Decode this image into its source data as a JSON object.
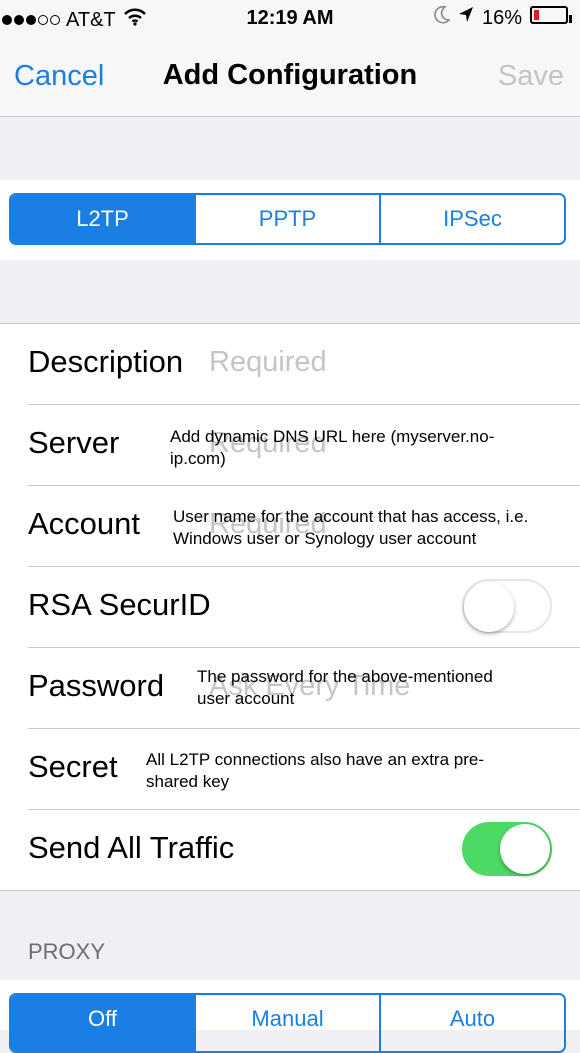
{
  "status_bar": {
    "carrier": "AT&T",
    "time": "12:19 AM",
    "battery": "16%",
    "signal_bars": 3,
    "signal_total": 5,
    "battery_level": 0.16
  },
  "nav": {
    "cancel": "Cancel",
    "title": "Add Configuration",
    "save": "Save"
  },
  "vpn_type": {
    "options": [
      "L2TP",
      "PPTP",
      "IPSec"
    ],
    "selected": "L2TP"
  },
  "form": {
    "description": {
      "label": "Description",
      "placeholder": "Required"
    },
    "server": {
      "label": "Server",
      "placeholder": "Required",
      "note": "Add dynamic DNS URL here (myserver.no-ip.com)"
    },
    "account": {
      "label": "Account",
      "placeholder": "Required",
      "note": "User name for the account that has access, i.e. Windows user or Synology user account"
    },
    "rsa": {
      "label": "RSA SecurID",
      "enabled": false
    },
    "password": {
      "label": "Password",
      "placeholder": "Ask Every Time",
      "note": "The password for the above-mentioned user account"
    },
    "secret": {
      "label": "Secret",
      "note": "All L2TP connections also have an extra pre-shared key"
    },
    "send_all": {
      "label": "Send All Traffic",
      "enabled": true
    }
  },
  "proxy": {
    "header": "PROXY",
    "options": [
      "Off",
      "Manual",
      "Auto"
    ],
    "selected": "Off"
  },
  "colors": {
    "accent": "#1a7fe3",
    "toggle_on": "#4cd964",
    "placeholder": "#c4c4c9",
    "battery_low": "#e01c1c"
  }
}
